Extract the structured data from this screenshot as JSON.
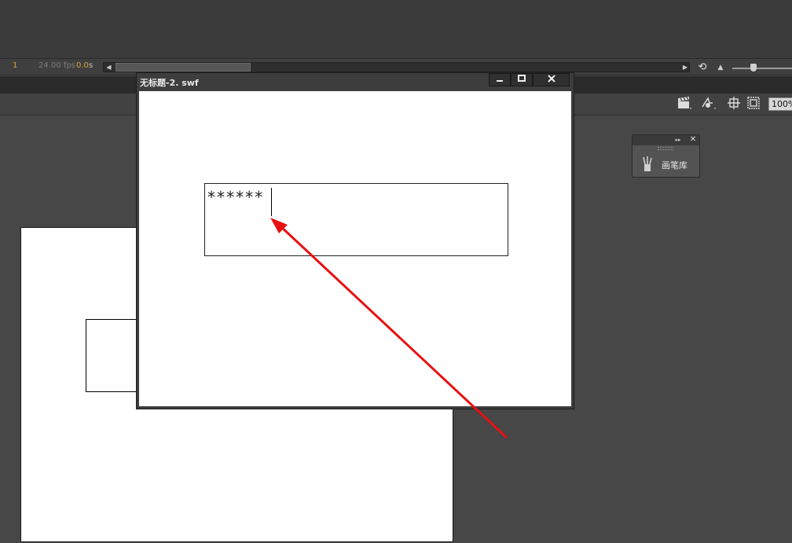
{
  "timeline": {
    "frame": "1",
    "fps": "24.00 fps",
    "time_value": "0.0",
    "time_unit": "s",
    "scroll_left_icon": "arrow-left-icon",
    "scroll_right_icon": "arrow-right-icon",
    "loop_icon": "loop-icon",
    "zoom_out_icon": "mountain-small-icon"
  },
  "edit_bar": {
    "icons": [
      "clapper-icon",
      "symbol-icon",
      "center-stage-icon",
      "clip-icon"
    ],
    "zoom": "100%"
  },
  "brush_panel": {
    "label": "画笔库",
    "icon": "brush-library-icon"
  },
  "swf_window": {
    "title": "无标题-2. swf",
    "min_label": "▁",
    "max_label": "□",
    "close_label": "✕"
  },
  "password_field": {
    "value": "******"
  },
  "annotation": {
    "arrow_color": "#e81010"
  },
  "colors": {
    "accent_orange": "#d9a33a",
    "background": "#474747"
  }
}
